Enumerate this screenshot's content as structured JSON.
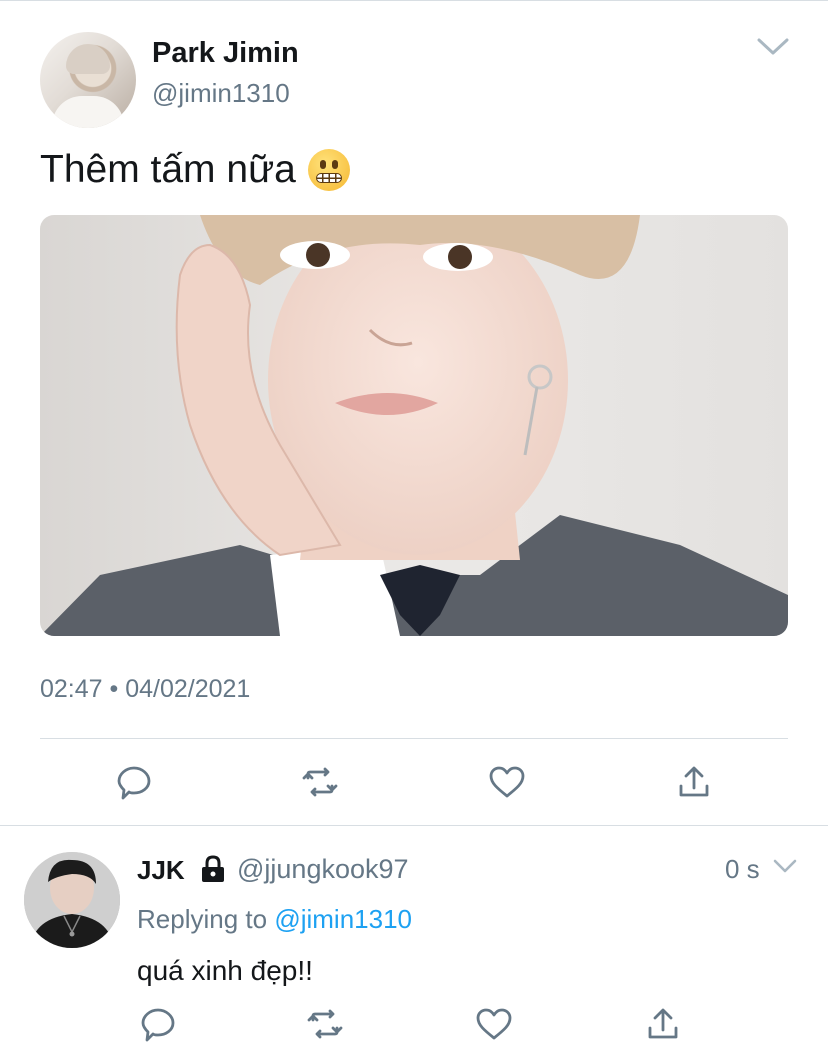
{
  "tweet": {
    "author_name": "Park Jimin",
    "author_handle": "@jimin1310",
    "text": "Thêm tấm nữa",
    "emoji": "grimacing-face-icon",
    "timestamp": "02:47 • 04/02/2021"
  },
  "reply": {
    "author_name": "JJK",
    "protected_icon": "lock-icon",
    "author_handle": "@jjungkook97",
    "time": "0 s",
    "replying_prefix": "Replying to ",
    "replying_handle": "@jimin1310",
    "text": "quá xinh đẹp!!"
  },
  "actions": [
    "reply-icon",
    "retweet-icon",
    "like-icon",
    "share-icon"
  ],
  "colors": {
    "text": "#14171a",
    "secondary": "#657786",
    "link": "#1da1f2",
    "divider": "#d8dee3"
  }
}
